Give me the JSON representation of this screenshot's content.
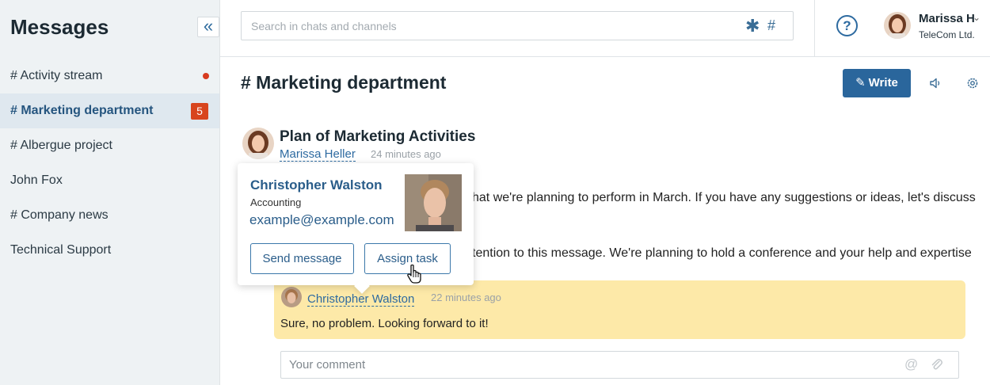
{
  "sidebar": {
    "title": "Messages",
    "collapse_icon": "«",
    "items": [
      {
        "label": "# Activity stream",
        "unread_dot": true
      },
      {
        "label": "# Marketing department",
        "badge": "5",
        "active": true
      },
      {
        "label": "# Albergue project"
      },
      {
        "label": "John Fox"
      },
      {
        "label": "# Company news"
      },
      {
        "label": "Technical Support"
      }
    ]
  },
  "header": {
    "search_placeholder": "Search in chats and channels",
    "search_star_icon": "asterisk-icon",
    "search_hash_icon": "#",
    "help_icon": "?",
    "user_name": "Marissa H",
    "user_company": "TeleCom Ltd."
  },
  "channel": {
    "title": "# Marketing department",
    "write_label": "Write"
  },
  "post": {
    "title": "Plan of Marketing Activities",
    "author": "Marissa Heller",
    "time": "24 minutes ago",
    "text_line1": "hat we're planning to perform in March. If you have any suggestions or ideas, let's discuss",
    "text_line2": "tention to this message. We're planning to hold a conference and your help and expertise"
  },
  "comment": {
    "author": "Christopher Walston",
    "time": "22 minutes ago",
    "text": "Sure, no problem. Looking forward to it!"
  },
  "comment_box": {
    "placeholder": "Your comment",
    "at_icon": "@"
  },
  "card": {
    "name": "Christopher Walston",
    "department": "Accounting",
    "email": "example@example.com",
    "send_label": "Send message",
    "assign_label": "Assign task"
  },
  "colors": {
    "accent": "#2a669c",
    "badge": "#d8451e",
    "comment_bg": "#fde9a8",
    "sidebar_bg": "#eef2f4"
  }
}
